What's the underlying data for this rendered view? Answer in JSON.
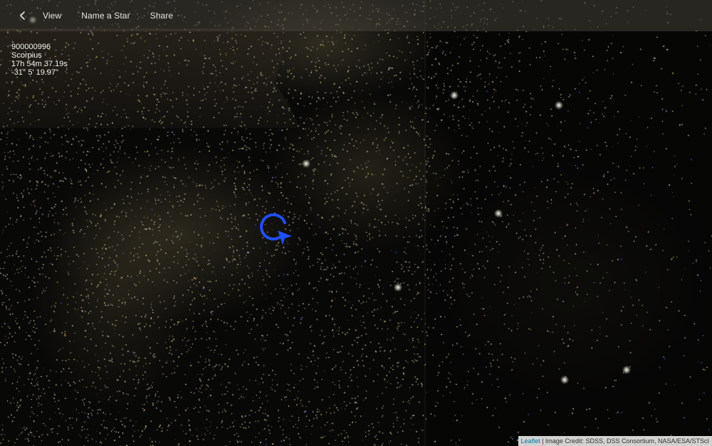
{
  "toolbar": {
    "back_icon": "chevron-left-icon",
    "items": [
      {
        "label": "View"
      },
      {
        "label": "Name a Star"
      },
      {
        "label": "Share"
      }
    ]
  },
  "star": {
    "id": "900000996",
    "constellation": "Scorpius",
    "right_ascension": "17h 54m 37.19s",
    "declination": "-31° 5' 19.97\""
  },
  "marker": {
    "icon": "locate-star-icon",
    "color": "#1f4fff"
  },
  "attribution": {
    "link_label": "Leaflet",
    "separator": " | ",
    "credit": "Image Credit: SDSS, DSS Consortium, NASA/ESA/STScI"
  }
}
